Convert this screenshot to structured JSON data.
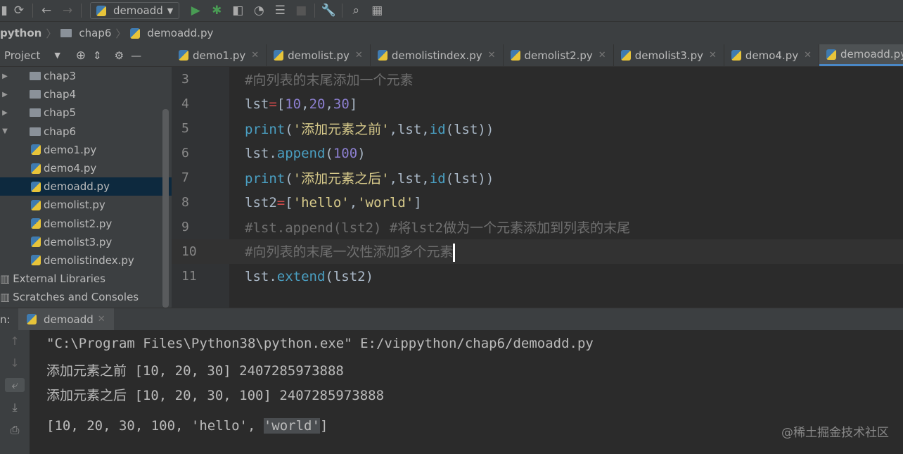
{
  "toolbar": {
    "run_config": "demoadd"
  },
  "breadcrumb": [
    "python",
    "chap6",
    "demoadd.py"
  ],
  "project": {
    "title": "Project",
    "tree": [
      {
        "label": "chap3",
        "type": "folder",
        "expanded": false
      },
      {
        "label": "chap4",
        "type": "folder",
        "expanded": false
      },
      {
        "label": "chap5",
        "type": "folder",
        "expanded": false
      },
      {
        "label": "chap6",
        "type": "folder",
        "expanded": true
      },
      {
        "label": "demo1.py",
        "type": "file"
      },
      {
        "label": "demo4.py",
        "type": "file"
      },
      {
        "label": "demoadd.py",
        "type": "file",
        "selected": true
      },
      {
        "label": "demolist.py",
        "type": "file"
      },
      {
        "label": "demolist2.py",
        "type": "file"
      },
      {
        "label": "demolist3.py",
        "type": "file"
      },
      {
        "label": "demolistindex.py",
        "type": "file"
      },
      {
        "label": "External Libraries",
        "type": "lib"
      },
      {
        "label": "Scratches and Consoles",
        "type": "lib"
      }
    ]
  },
  "tabs": [
    {
      "label": "demo1.py"
    },
    {
      "label": "demolist.py"
    },
    {
      "label": "demolistindex.py"
    },
    {
      "label": "demolist2.py"
    },
    {
      "label": "demolist3.py"
    },
    {
      "label": "demo4.py"
    },
    {
      "label": "demoadd.py",
      "active": true
    }
  ],
  "editor": {
    "lines": [
      {
        "n": "3",
        "tokens": [
          [
            "#向列表的末尾添加一个元素",
            "cm"
          ]
        ]
      },
      {
        "n": "4",
        "tokens": [
          [
            "lst",
            "kw"
          ],
          [
            "=",
            "op"
          ],
          [
            "[",
            "kw"
          ],
          [
            "10",
            "num"
          ],
          [
            ",",
            "kw"
          ],
          [
            "20",
            "num"
          ],
          [
            ",",
            "kw"
          ],
          [
            "30",
            "num"
          ],
          [
            "]",
            "kw"
          ]
        ]
      },
      {
        "n": "5",
        "tokens": [
          [
            "print",
            "fn"
          ],
          [
            "(",
            "kw"
          ],
          [
            "'添加元素之前'",
            "str"
          ],
          [
            ",lst,",
            "kw"
          ],
          [
            "id",
            "fn"
          ],
          [
            "(lst))",
            "kw"
          ]
        ]
      },
      {
        "n": "6",
        "tokens": [
          [
            "lst.",
            "kw"
          ],
          [
            "append",
            "fn"
          ],
          [
            "(",
            "kw"
          ],
          [
            "100",
            "num"
          ],
          [
            ")",
            "kw"
          ]
        ]
      },
      {
        "n": "7",
        "tokens": [
          [
            "print",
            "fn"
          ],
          [
            "(",
            "kw"
          ],
          [
            "'添加元素之后'",
            "str"
          ],
          [
            ",lst,",
            "kw"
          ],
          [
            "id",
            "fn"
          ],
          [
            "(lst))",
            "kw"
          ]
        ]
      },
      {
        "n": "8",
        "tokens": [
          [
            "lst2",
            "kw"
          ],
          [
            "=",
            "op"
          ],
          [
            "[",
            "kw"
          ],
          [
            "'hello'",
            "str"
          ],
          [
            ",",
            "kw"
          ],
          [
            "'world'",
            "str"
          ],
          [
            "]",
            "kw"
          ]
        ]
      },
      {
        "n": "9",
        "tokens": [
          [
            "#lst.append(lst2) #将lst2做为一个元素添加到列表的末尾",
            "cm"
          ]
        ]
      },
      {
        "n": "10",
        "tokens": [
          [
            "#向列表的末尾一次性添加多个元素",
            "cm"
          ]
        ],
        "current": true
      },
      {
        "n": "11",
        "tokens": [
          [
            "lst.",
            "kw"
          ],
          [
            "extend",
            "fn"
          ],
          [
            "(lst2)",
            "kw"
          ]
        ]
      }
    ]
  },
  "run": {
    "label": "n:",
    "tab": "demoadd",
    "output": [
      "\"C:\\Program Files\\Python38\\python.exe\" E:/vippython/chap6/demoadd.py",
      "添加元素之前 [10, 20, 30] 2407285973888",
      "添加元素之后 [10, 20, 30, 100] 2407285973888"
    ],
    "last_line_pre": "[10, 20, 30, 100, 'hello', ",
    "last_line_sel": "'world'",
    "last_line_post": "]"
  },
  "watermark": "@稀土掘金技术社区"
}
